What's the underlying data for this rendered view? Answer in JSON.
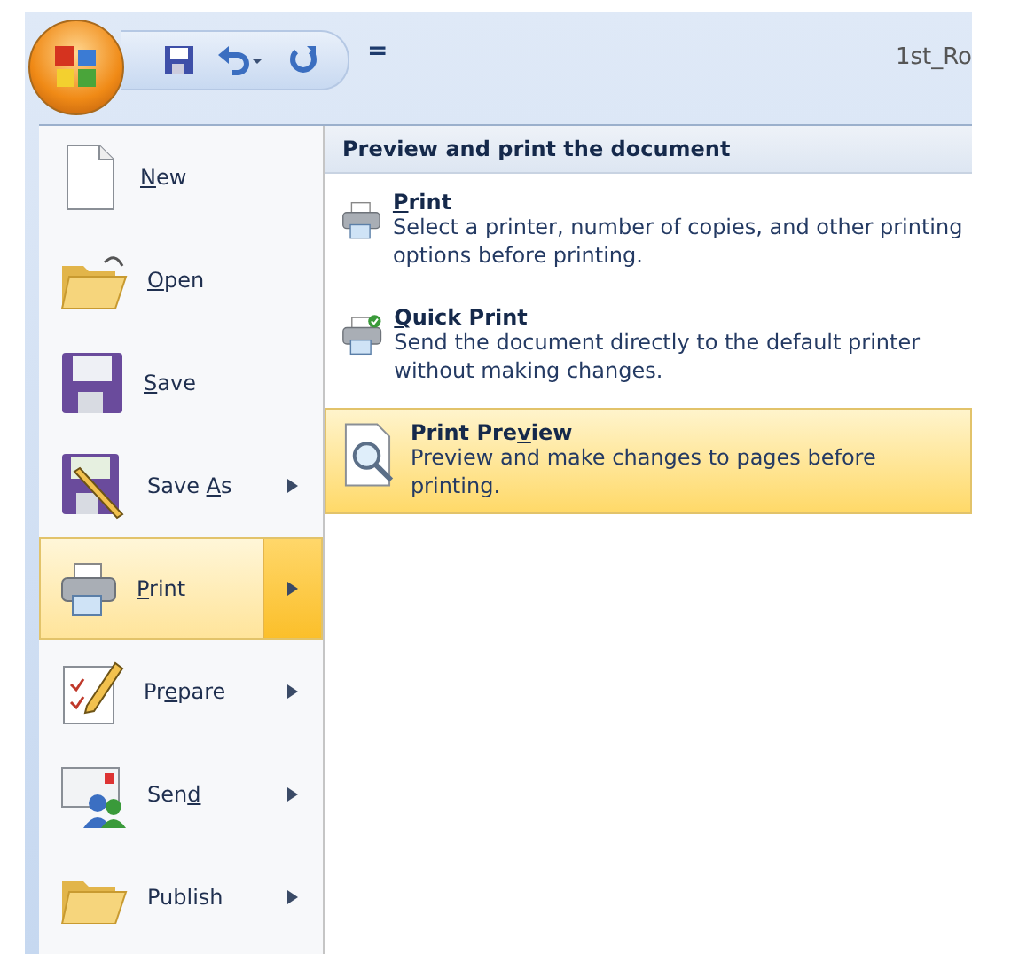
{
  "window": {
    "title": "1st_Ro"
  },
  "quick_access": {
    "customize_glyph": "="
  },
  "menu": {
    "items": [
      {
        "label": {
          "key": "N",
          "post": "ew"
        },
        "kind": "new",
        "submenu": false,
        "selected": false
      },
      {
        "label": {
          "key": "O",
          "post": "pen"
        },
        "kind": "open",
        "submenu": false,
        "selected": false
      },
      {
        "label": {
          "key": "S",
          "post": "ave"
        },
        "kind": "save",
        "submenu": false,
        "selected": false
      },
      {
        "label": {
          "pre": "Save ",
          "key": "A",
          "post": "s"
        },
        "kind": "saveas",
        "submenu": true,
        "selected": false
      },
      {
        "label": {
          "key": "P",
          "post": "rint"
        },
        "kind": "print",
        "submenu": true,
        "selected": true
      },
      {
        "label": {
          "pre": "Pr",
          "key": "e",
          "post": "pare"
        },
        "kind": "prepare",
        "submenu": true,
        "selected": false
      },
      {
        "label": {
          "pre": "Sen",
          "key": "d"
        },
        "kind": "send",
        "submenu": true,
        "selected": false
      },
      {
        "label": {
          "pre": "Publish"
        },
        "kind": "publish",
        "submenu": true,
        "selected": false
      }
    ]
  },
  "submenu": {
    "heading": "Preview and print the document",
    "items": [
      {
        "title": {
          "key": "P",
          "post": "rint"
        },
        "description": "Select a printer, number of copies, and other printing options before printing.",
        "kind": "print",
        "selected": false
      },
      {
        "title": {
          "key": "Q",
          "post": "uick Print"
        },
        "description": "Send the document directly to the default printer without making changes.",
        "kind": "quickprint",
        "selected": false
      },
      {
        "title": {
          "pre": "Print Pre",
          "key": "v",
          "post": "iew"
        },
        "description": "Preview and make changes to pages before printing.",
        "kind": "preview",
        "selected": true
      }
    ]
  }
}
